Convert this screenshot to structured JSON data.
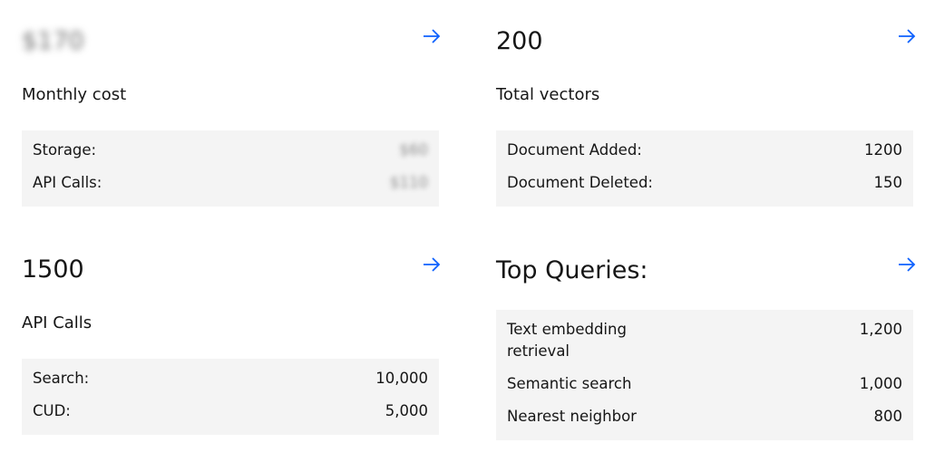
{
  "cards": {
    "cost": {
      "value": "$170",
      "subtitle": "Monthly cost",
      "rows": [
        {
          "label": "Storage:",
          "value": "$60"
        },
        {
          "label": "API Calls:",
          "value": "$110"
        }
      ]
    },
    "vectors": {
      "value": "200",
      "subtitle": "Total vectors",
      "rows": [
        {
          "label": "Document Added:",
          "value": "1200"
        },
        {
          "label": "Document Deleted:",
          "value": "150"
        }
      ]
    },
    "api": {
      "value": "1500",
      "subtitle": "API Calls",
      "rows": [
        {
          "label": "Search:",
          "value": "10,000"
        },
        {
          "label": "CUD:",
          "value": "5,000"
        }
      ]
    },
    "queries": {
      "title": "Top Queries:",
      "rows": [
        {
          "label": "Text embedding retrieval",
          "value": "1,200"
        },
        {
          "label": "Semantic search",
          "value": "1,000"
        },
        {
          "label": "Nearest neighbor",
          "value": "800"
        }
      ]
    }
  },
  "colors": {
    "accent": "#0f62fe",
    "panel": "#f4f4f4",
    "text": "#161616"
  },
  "icons": {
    "arrow": "arrow-right-icon"
  }
}
